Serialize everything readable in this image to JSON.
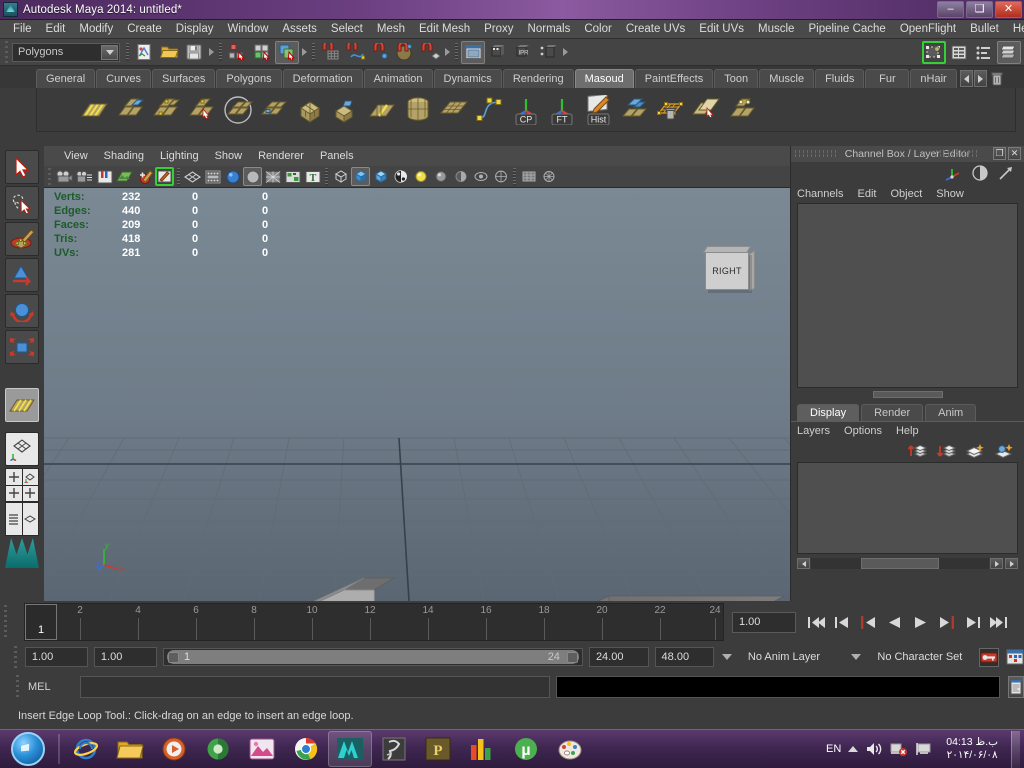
{
  "window": {
    "title": "Autodesk Maya 2014: untitled*",
    "app_icon": "maya-logo-icon",
    "buttons": {
      "minimize": "–",
      "maximize": "❑",
      "close": "✕"
    }
  },
  "menubar": {
    "items": [
      "File",
      "Edit",
      "Modify",
      "Create",
      "Display",
      "Window",
      "Assets",
      "Select",
      "Mesh",
      "Edit Mesh",
      "Proxy",
      "Normals",
      "Color",
      "Create UVs",
      "Edit UVs",
      "Muscle",
      "Pipeline Cache",
      "OpenFlight",
      "Bullet",
      "Help"
    ]
  },
  "statusline": {
    "selection_mode": "Polygons",
    "icons_left": [
      "new-scene-icon",
      "open-scene-icon",
      "save-scene-icon"
    ],
    "icons_select": [
      "select-by-hierarchy-icon",
      "select-by-object-icon",
      "select-by-component-icon"
    ],
    "icons_snap": [
      "snap-to-grid-icon",
      "snap-to-curve-icon",
      "snap-to-point-icon",
      "snap-to-view-plane-icon",
      "snap-to-projected-center-icon"
    ],
    "icons_render": [
      "render-current-frame-icon",
      "ipr-render-icon",
      "render-settings-icon",
      "render-sequence-icon"
    ],
    "icons_right": [
      "show-manipulator-icon",
      "attribute-editor-icon",
      "tool-settings-icon",
      "channel-box-icon"
    ]
  },
  "shelf": {
    "tabs": [
      "General",
      "Curves",
      "Surfaces",
      "Polygons",
      "Deformation",
      "Animation",
      "Dynamics",
      "Rendering",
      "Masoud",
      "PaintEffects",
      "Toon",
      "Muscle",
      "Fluids",
      "Fur",
      "nHair"
    ],
    "active_tab": "Masoud",
    "nav": {
      "prev": "prev-shelf-tab",
      "next": "next-shelf-tab",
      "delete": "delete-shelf-item"
    },
    "buttons": [
      {
        "name": "insert-edge-loop-tool-icon",
        "label": "insert edge loop"
      },
      {
        "name": "append-to-polygon-tool-icon",
        "label": "append to polygon"
      },
      {
        "name": "split-polygon-tool-icon",
        "label": "split polygon"
      },
      {
        "name": "interactive-split-tool-icon",
        "label": "interactive split"
      },
      {
        "name": "smooth-polygon-icon",
        "label": "smooth"
      },
      {
        "name": "combine-polygons-icon",
        "label": "combine"
      },
      {
        "name": "extrude-face-icon",
        "label": "extrude"
      },
      {
        "name": "bevel-icon",
        "label": "bevel"
      },
      {
        "name": "offset-edge-loop-icon",
        "label": "offset edge loop"
      },
      {
        "name": "poly-cylinder-icon",
        "label": "cylinder"
      },
      {
        "name": "poly-plane-icon",
        "label": "plane"
      },
      {
        "name": "ep-curve-tool-icon",
        "label": "ep curve"
      },
      {
        "name": "center-pivot-icon",
        "label": "CP"
      },
      {
        "name": "freeze-transform-icon",
        "label": "FT"
      },
      {
        "name": "delete-history-icon",
        "label": "Hist"
      },
      {
        "name": "merge-vertices-icon",
        "label": "merge"
      },
      {
        "name": "delete-vertex-icon",
        "label": "delete vertex"
      },
      {
        "name": "duplicate-face-icon",
        "label": "duplicate face"
      },
      {
        "name": "target-weld-tool-icon",
        "label": "target weld"
      }
    ],
    "button_text": {
      "cp": "CP",
      "ft": "FT",
      "hist": "Hist"
    }
  },
  "toolbox": {
    "tools": [
      {
        "name": "select-tool",
        "label": "Select Tool",
        "selected": false
      },
      {
        "name": "lasso-select-tool",
        "label": "Lasso Select Tool",
        "selected": false
      },
      {
        "name": "paint-select-tool",
        "label": "Paint Selection Tool",
        "selected": false
      },
      {
        "name": "move-tool",
        "label": "Move Tool",
        "selected": false
      },
      {
        "name": "rotate-tool",
        "label": "Rotate Tool",
        "selected": false
      },
      {
        "name": "scale-tool",
        "label": "Scale Tool",
        "selected": false
      },
      {
        "name": "last-tool-used",
        "label": "Insert Edge Loop Tool",
        "selected": true
      }
    ],
    "layouts": [
      {
        "name": "single-perspective-layout"
      },
      {
        "name": "four-view-layout"
      },
      {
        "name": "outliner-persp-layout"
      }
    ]
  },
  "viewport": {
    "menus": [
      "View",
      "Shading",
      "Lighting",
      "Show",
      "Renderer",
      "Panels"
    ],
    "toolbar_icons": [
      "select-camera-icon",
      "camera-attributes-icon",
      "bookmarks-icon",
      "image-plane-icon",
      "grease-pencil-icon",
      "two-dimensional-pan-zoom-icon",
      "wireframe-icon",
      "smooth-shade-icon",
      "smooth-shade-all-icon",
      "flat-shade-icon",
      "shaded-wireframe-icon",
      "textured-icon",
      "use-default-light-icon",
      "bounding-box-icon",
      "shade-objects-icon",
      "shade-options-icon",
      "xray-icon",
      "lights-icon",
      "shadows-icon",
      "occlusion-icon",
      "motion-blur-icon",
      "isolate-select-icon",
      "grid-icon",
      "exposure-icon"
    ],
    "hud": {
      "columns": [
        "name",
        "total",
        "selected",
        "other"
      ],
      "rows": [
        {
          "label": "Verts:",
          "total": "232",
          "selected": "0",
          "other": "0"
        },
        {
          "label": "Edges:",
          "total": "440",
          "selected": "0",
          "other": "0"
        },
        {
          "label": "Faces:",
          "total": "209",
          "selected": "0",
          "other": "0"
        },
        {
          "label": "Tris:",
          "total": "418",
          "selected": "0",
          "other": "0"
        },
        {
          "label": "UVs:",
          "total": "281",
          "selected": "0",
          "other": "0"
        }
      ]
    },
    "view_cube_label": "RIGHT",
    "axis_labels": {
      "x": "x",
      "y": "y",
      "z": "z"
    }
  },
  "channel_box": {
    "title": "Channel Box / Layer Editor",
    "window_buttons": {
      "float": "❐",
      "close": "✕"
    },
    "header_icons": [
      "channel-box-icon",
      "attribute-editor-icon",
      "show-manipulator-icon"
    ],
    "menus": [
      "Channels",
      "Edit",
      "Object",
      "Show"
    ],
    "layer_editor": {
      "tabs": [
        "Display",
        "Render",
        "Anim"
      ],
      "active_tab": "Display",
      "menus": [
        "Layers",
        "Options",
        "Help"
      ],
      "icons": [
        "move-layer-up-icon",
        "move-layer-down-icon",
        "new-layer-icon",
        "new-layer-from-selected-icon"
      ]
    }
  },
  "time_slider": {
    "tick_labels": [
      "2",
      "4",
      "6",
      "8",
      "10",
      "12",
      "14",
      "16",
      "18",
      "20",
      "22",
      "24"
    ],
    "current_frame": "1",
    "playback_speed_field": "1.00",
    "transport": [
      {
        "name": "go-to-start-button",
        "glyph": "start"
      },
      {
        "name": "step-back-keyframe-button",
        "glyph": "prevkey"
      },
      {
        "name": "step-back-frame-button",
        "glyph": "prevframe"
      },
      {
        "name": "play-backwards-button",
        "glyph": "playback"
      },
      {
        "name": "play-forwards-button",
        "glyph": "play"
      },
      {
        "name": "step-forward-frame-button",
        "glyph": "nextframe"
      },
      {
        "name": "step-forward-keyframe-button",
        "glyph": "nextkey"
      },
      {
        "name": "go-to-end-button",
        "glyph": "end"
      }
    ]
  },
  "range_slider": {
    "anim_start": "1.00",
    "range_start": "1.00",
    "bar_min": "1",
    "bar_max": "24",
    "range_end": "24.00",
    "anim_end": "48.00",
    "anim_layer": "No Anim Layer",
    "character_set": "No Character Set",
    "icons": [
      "auto-keyframe-icon",
      "animation-preferences-icon"
    ]
  },
  "command_line": {
    "label": "MEL",
    "input_value": "",
    "output_value": "",
    "script_editor_icon": "script-editor-icon"
  },
  "help_line": {
    "message": "Insert Edge Loop Tool.: Click-drag on an edge to insert an edge loop."
  },
  "taskbar": {
    "start": "start-orb",
    "apps": [
      {
        "name": "internet-explorer-taskbar-icon",
        "color": "#2f7fd0"
      },
      {
        "name": "file-explorer-taskbar-icon",
        "color": "#e8b44a"
      },
      {
        "name": "media-player-taskbar-icon",
        "color": "#d75a2a"
      },
      {
        "name": "firefox-taskbar-icon",
        "color": "#4caf50"
      },
      {
        "name": "image-viewer-taskbar-icon",
        "color": "#d44a8a"
      },
      {
        "name": "google-chrome-taskbar-icon",
        "color": "#4285f4"
      },
      {
        "name": "autodesk-maya-taskbar-icon",
        "color": "#19a7a7"
      },
      {
        "name": "zbrush-taskbar-icon",
        "color": "#9a9a9a"
      },
      {
        "name": "photo-editor-taskbar-icon",
        "color": "#8a7b3a"
      },
      {
        "name": "charts-taskbar-icon",
        "color": "#e84a2a"
      },
      {
        "name": "utorrent-taskbar-icon",
        "color": "#4caf50"
      },
      {
        "name": "paint-taskbar-icon",
        "color": "#d0423a"
      }
    ],
    "tray": {
      "language": "EN",
      "icons": [
        "show-hidden-icons-arrow",
        "volume-icon",
        "network-error-icon",
        "action-center-icon"
      ],
      "time": "ب.ظ 04:13",
      "date": "۲۰۱۴/۰۶/۰۸"
    }
  },
  "colors": {
    "title_purple": "#6b3f80",
    "panel_gray": "#3c3c3c",
    "accent_green": "#35d035",
    "hud_green": "#1d5b2a",
    "viewport_top": "#76838f",
    "viewport_bottom": "#5d6a77"
  }
}
